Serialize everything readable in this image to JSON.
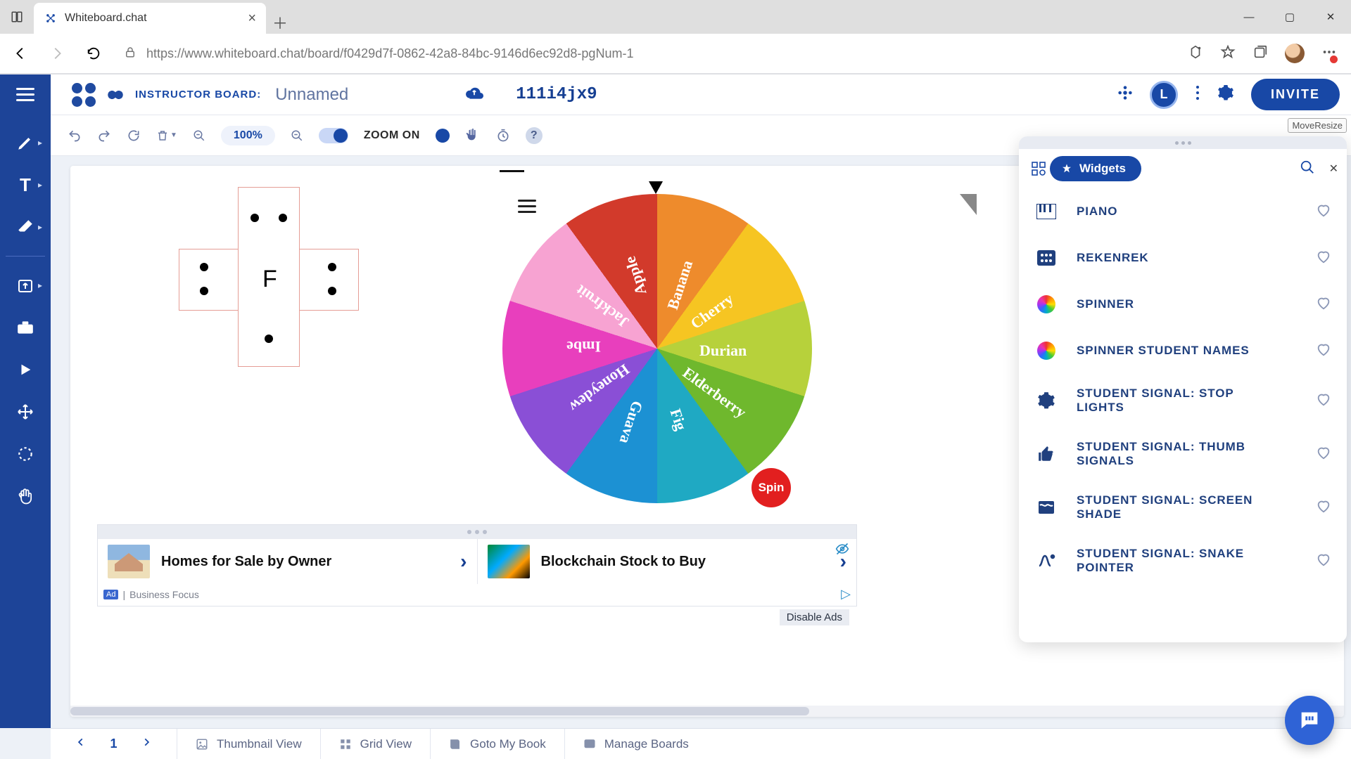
{
  "browser": {
    "tab_title": "Whiteboard.chat",
    "url": "https://www.whiteboard.chat/board/f0429d7f-0862-42a8-84bc-9146d6ec92d8-pgNum-1"
  },
  "appbar": {
    "board_label": "INSTRUCTOR BOARD:",
    "board_name": "Unnamed",
    "join_code": "111i4jx9",
    "user_initial": "L",
    "invite_label": "INVITE"
  },
  "toolbar2": {
    "zoom_pct": "100%",
    "zoom_on": "ZOOM ON"
  },
  "moveresize": "MoveResize",
  "cross": {
    "letter": "F"
  },
  "spinner": {
    "segments": [
      "Banana",
      "Cherry",
      "Durian",
      "Elderberry",
      "Fig",
      "Guava",
      "Honeydew",
      "Imbe",
      "Jackfruit",
      "Apple"
    ],
    "spin_label": "Spin"
  },
  "ads": {
    "item1": "Homes for Sale by Owner",
    "item2": "Blockchain Stock to Buy",
    "source": "Business Focus",
    "ad_tag": "Ad",
    "disable": "Disable Ads"
  },
  "widgets_panel": {
    "title": "Widgets",
    "items": [
      {
        "label": "PIANO",
        "icon": "piano"
      },
      {
        "label": "REKENREK",
        "icon": "rekenrek"
      },
      {
        "label": "SPINNER",
        "icon": "rainbow"
      },
      {
        "label": "SPINNER STUDENT NAMES",
        "icon": "rainbow"
      },
      {
        "label": "STUDENT SIGNAL: STOP LIGHTS",
        "icon": "gear"
      },
      {
        "label": "STUDENT SIGNAL: THUMB SIGNALS",
        "icon": "thumb"
      },
      {
        "label": "STUDENT SIGNAL: SCREEN SHADE",
        "icon": "shade"
      },
      {
        "label": "STUDENT SIGNAL: SNAKE POINTER",
        "icon": "snake"
      }
    ]
  },
  "bottombar": {
    "page": "1",
    "thumb": "Thumbnail View",
    "grid": "Grid View",
    "book": "Goto My Book",
    "manage": "Manage Boards"
  }
}
